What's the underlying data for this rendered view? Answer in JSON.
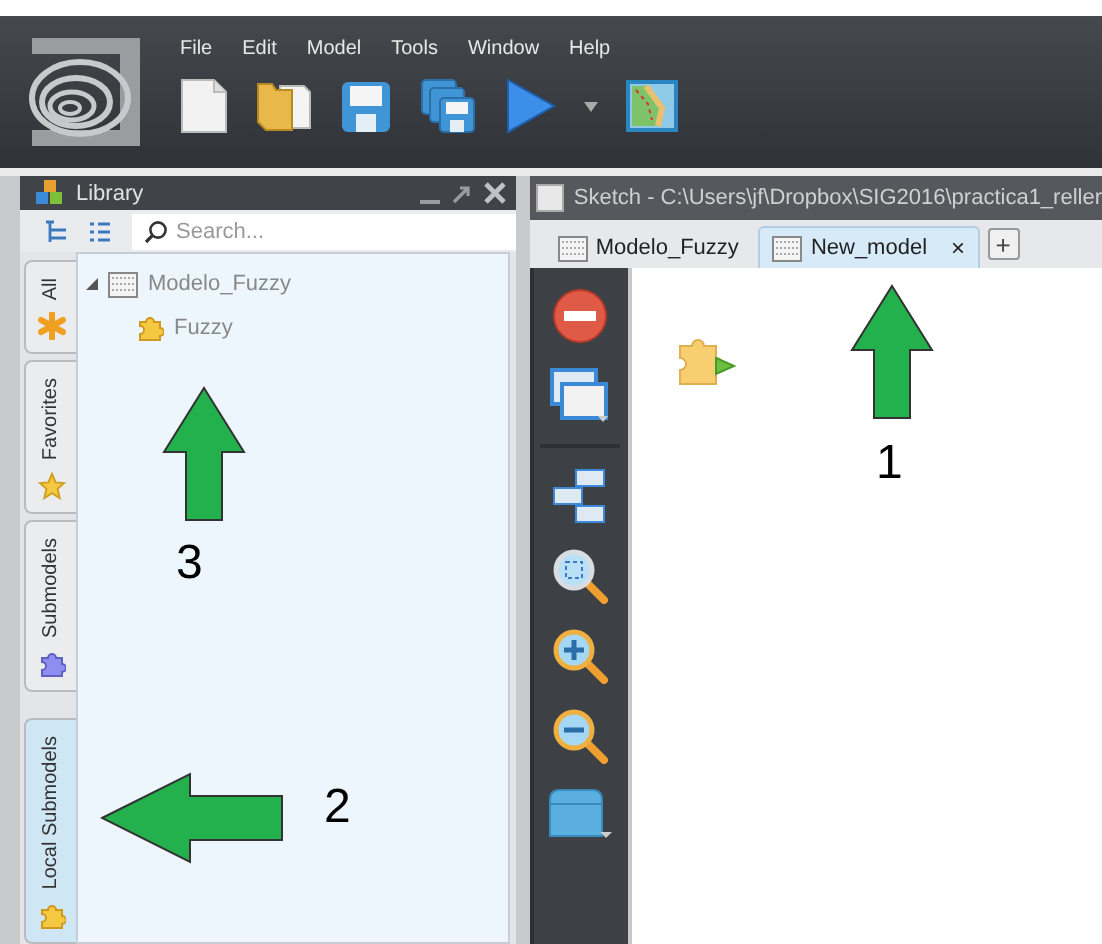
{
  "menu": [
    "File",
    "Edit",
    "Model",
    "Tools",
    "Window",
    "Help"
  ],
  "library": {
    "title": "Library",
    "search": {
      "placeholder": "Search..."
    },
    "side_tabs": [
      {
        "label": "All",
        "selected": false
      },
      {
        "label": "Favorites",
        "selected": false
      },
      {
        "label": "Submodels",
        "selected": false
      },
      {
        "label": "Local Submodels",
        "selected": true
      }
    ],
    "tree": [
      {
        "label": "Modelo_Fuzzy",
        "expanded": true,
        "children": [
          {
            "label": "Fuzzy"
          }
        ]
      }
    ]
  },
  "sketch": {
    "title": "Sketch - C:\\Users\\jf\\Dropbox\\SIG2016\\practica1_reller",
    "add_tab": "+",
    "tabs": [
      {
        "label": "Modelo_Fuzzy",
        "selected": false
      },
      {
        "label": "New_model",
        "selected": true,
        "close": "×"
      }
    ]
  },
  "annotations": [
    {
      "label": "1",
      "kind": "up"
    },
    {
      "label": "2",
      "kind": "left"
    },
    {
      "label": "3",
      "kind": "up"
    }
  ]
}
